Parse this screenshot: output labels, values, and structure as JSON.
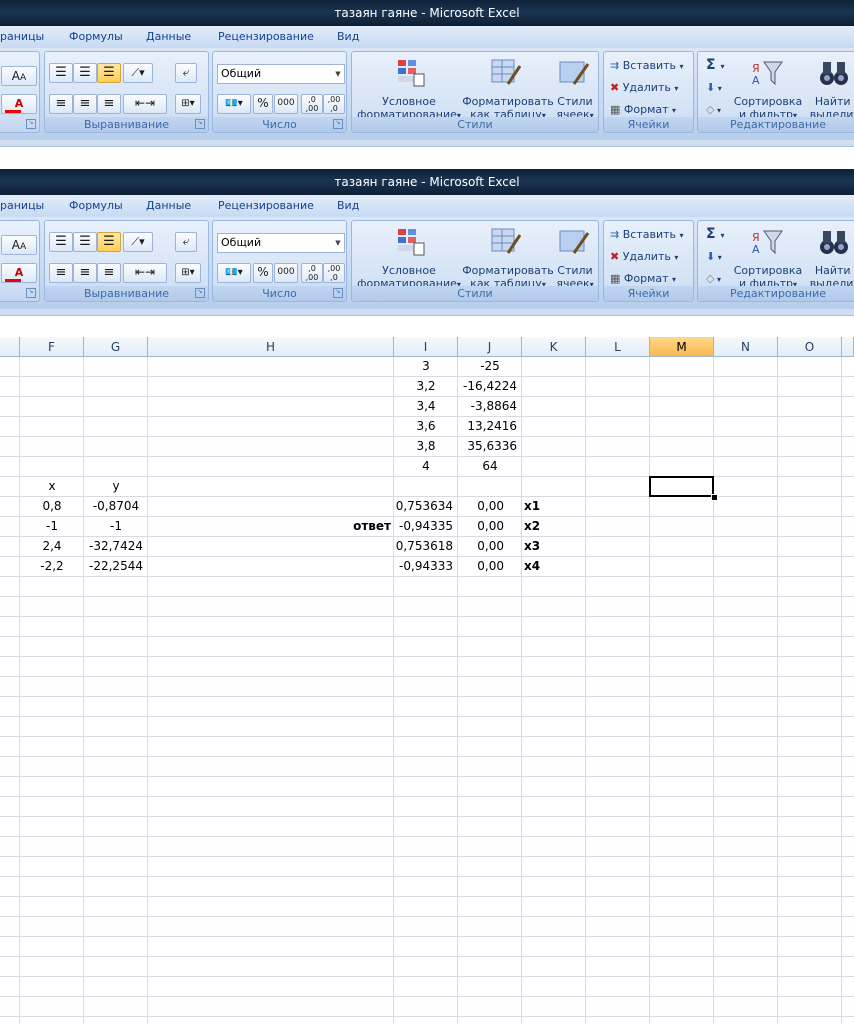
{
  "windows": [
    {
      "title": "тазаян гаяне - Microsoft Excel"
    },
    {
      "title": "тазаян гаяне - Microsoft Excel"
    }
  ],
  "tabs": [
    "раницы",
    "Формулы",
    "Данные",
    "Рецензирование",
    "Вид"
  ],
  "ribbon": {
    "number_format": "Общий",
    "groups": {
      "alignment": "Выравнивание",
      "number": "Число",
      "styles": "Стили",
      "cells": "Ячейки",
      "editing": "Редактирование"
    },
    "percent": "%",
    "thousands": "000",
    "dec_inc": ",0 ,00",
    "dec_dec": ",00 ,0",
    "cond_format": [
      "Условное",
      "форматирование"
    ],
    "format_table": [
      "Форматировать",
      "как таблицу"
    ],
    "cell_styles": [
      "Стили",
      "ячеек"
    ],
    "insert": "Вставить",
    "delete": "Удалить",
    "format": "Формат",
    "sort": [
      "Сортировка",
      "и фильтр"
    ],
    "find": [
      "Найти и",
      "выделить"
    ],
    "sigma": "Σ"
  },
  "columns": [
    "F",
    "G",
    "H",
    "I",
    "J",
    "K",
    "L",
    "M",
    "N",
    "O"
  ],
  "cells": {
    "I1": "3",
    "J1": "-25",
    "I2": "3,2",
    "J2": "-16,4224",
    "I3": "3,4",
    "J3": "-3,8864",
    "I4": "3,6",
    "J4": "13,2416",
    "I5": "3,8",
    "J5": "35,6336",
    "I6": "4",
    "J6": "64",
    "F7": "x",
    "G7": "y",
    "F8": "0,8",
    "G8": "-0,8704",
    "I8": "0,753634",
    "J8": "0,00",
    "K8": "x1",
    "F9": "-1",
    "G9": "-1",
    "H9": "ответ",
    "I9": "-0,94335",
    "J9": "0,00",
    "K9": "x2",
    "F10": "2,4",
    "G10": "-32,7424",
    "I10": "0,753618",
    "J10": "0,00",
    "K10": "x3",
    "F11": "-2,2",
    "G11": "-22,2544",
    "I11": "-0,94333",
    "J11": "0,00",
    "K11": "x4"
  }
}
